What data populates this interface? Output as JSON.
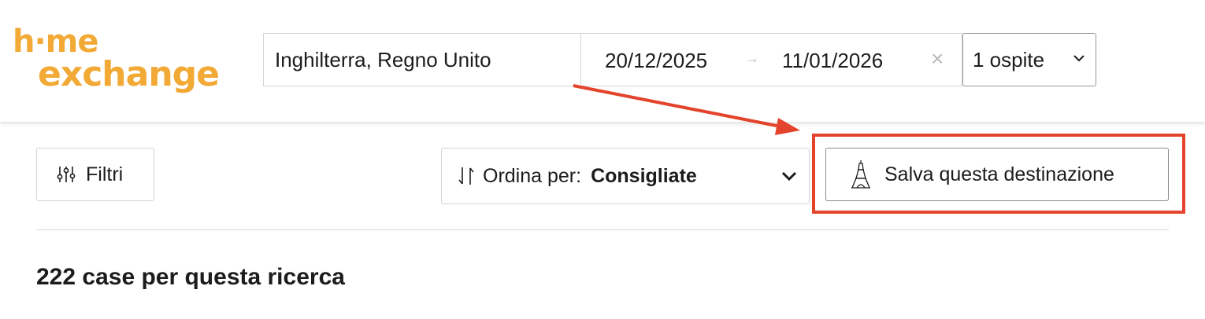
{
  "header": {
    "logo_line1": "h·me",
    "logo_line2": "exchange",
    "destination_value": "Inghilterra, Regno Unito",
    "date_start": "20/12/2025",
    "date_arrow": "→",
    "date_end": "11/01/2026",
    "date_clear": "×",
    "guests_value": "1 ospite"
  },
  "toolbar": {
    "filters_label": "Filtri",
    "sort_prefix": "Ordina per:",
    "sort_value": "Consigliate",
    "save_destination_label": "Salva questa destinazione"
  },
  "results": {
    "count_text": "222 case per questa ricerca"
  },
  "colors": {
    "brand_yellow": "#f2a935",
    "annotation_red": "#e4432c",
    "border_light": "#d4d4d4"
  },
  "icons": {
    "filters": "sliders-icon",
    "sort": "sort-arrows-icon",
    "save": "eiffel-tower-icon",
    "dropdown": "chevron-down-icon",
    "clear": "close-icon"
  }
}
